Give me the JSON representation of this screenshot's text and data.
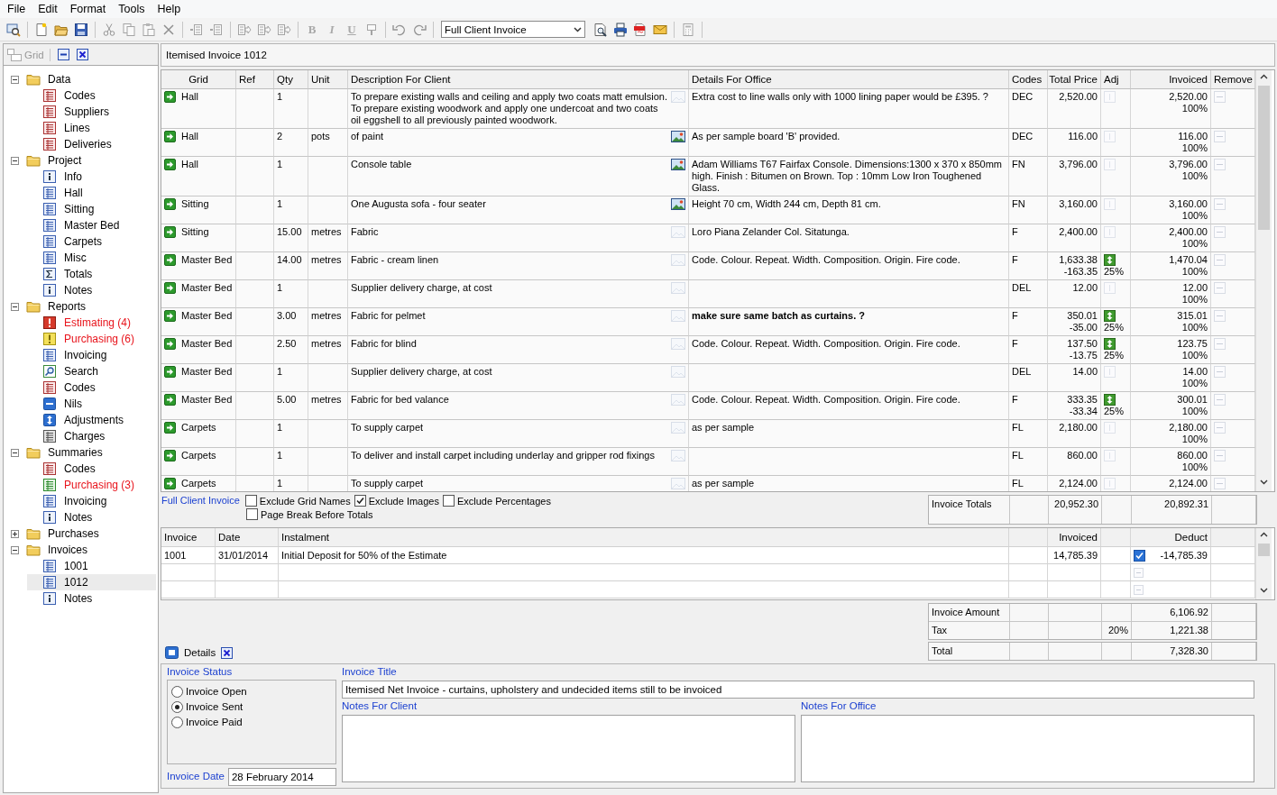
{
  "menu": [
    "File",
    "Edit",
    "Format",
    "Tools",
    "Help"
  ],
  "toolbar": {
    "groups": [
      [
        {
          "kind": "find-window",
          "disabled": false
        }
      ],
      [
        {
          "kind": "new",
          "disabled": false
        },
        {
          "kind": "open",
          "disabled": false
        },
        {
          "kind": "save",
          "disabled": false
        }
      ],
      [
        {
          "kind": "cut",
          "disabled": true
        },
        {
          "kind": "copy",
          "disabled": true
        },
        {
          "kind": "paste",
          "disabled": true
        },
        {
          "kind": "delete",
          "disabled": true
        }
      ],
      [
        {
          "kind": "outdent",
          "disabled": true
        },
        {
          "kind": "indent",
          "disabled": true
        }
      ],
      [
        {
          "kind": "column-in",
          "disabled": true
        },
        {
          "kind": "column-out",
          "disabled": true
        },
        {
          "kind": "column-right",
          "disabled": true
        }
      ],
      [
        {
          "kind": "bold",
          "glyph": "B",
          "disabled": true
        },
        {
          "kind": "italic",
          "glyph": "I",
          "disabled": true
        },
        {
          "kind": "underline",
          "glyph": "U",
          "disabled": true
        },
        {
          "kind": "highlight",
          "disabled": true
        }
      ],
      [
        {
          "kind": "undo",
          "disabled": true
        },
        {
          "kind": "redo",
          "disabled": true
        }
      ]
    ],
    "report": "Full Client Invoice",
    "actions": [
      [
        {
          "kind": "preview",
          "disabled": false
        },
        {
          "kind": "print",
          "disabled": false
        },
        {
          "kind": "pdf",
          "disabled": false
        },
        {
          "kind": "email",
          "disabled": false
        }
      ],
      [
        {
          "kind": "calculator",
          "disabled": true
        }
      ]
    ]
  },
  "sidebar": {
    "grid_button": {
      "label": "Grid",
      "disabled": true
    },
    "tree": [
      {
        "label": "Data",
        "kind": "folder",
        "expanded": true,
        "selected": false,
        "children": [
          {
            "label": "Codes",
            "kind": "table-red",
            "selected": false,
            "alert": false
          },
          {
            "label": "Suppliers",
            "kind": "table-red",
            "selected": false,
            "alert": false
          },
          {
            "label": "Lines",
            "kind": "table-red",
            "selected": false,
            "alert": false
          },
          {
            "label": "Deliveries",
            "kind": "table-red",
            "selected": false,
            "alert": false
          }
        ]
      },
      {
        "label": "Project",
        "kind": "folder",
        "expanded": true,
        "selected": false,
        "children": [
          {
            "label": "Info",
            "kind": "info",
            "selected": false,
            "alert": false
          },
          {
            "label": "Hall",
            "kind": "table-blue",
            "selected": false,
            "alert": false
          },
          {
            "label": "Sitting",
            "kind": "table-blue",
            "selected": false,
            "alert": false
          },
          {
            "label": "Master Bed",
            "kind": "table-blue",
            "selected": false,
            "alert": false
          },
          {
            "label": "Carpets",
            "kind": "table-blue",
            "selected": false,
            "alert": false
          },
          {
            "label": "Misc",
            "kind": "table-blue",
            "selected": false,
            "alert": false
          },
          {
            "label": "Totals",
            "kind": "totals",
            "selected": false,
            "alert": false
          },
          {
            "label": "Notes",
            "kind": "info",
            "selected": false,
            "alert": false
          }
        ]
      },
      {
        "label": "Reports",
        "kind": "folder",
        "expanded": true,
        "selected": false,
        "children": [
          {
            "label": "Estimating (4)",
            "kind": "alert-red",
            "selected": false,
            "alert": true
          },
          {
            "label": "Purchasing (6)",
            "kind": "alert-yellow",
            "selected": false,
            "alert": true
          },
          {
            "label": "Invoicing",
            "kind": "list-blue",
            "selected": false,
            "alert": false
          },
          {
            "label": "Search",
            "kind": "search",
            "selected": false,
            "alert": false
          },
          {
            "label": "Codes",
            "kind": "table-red",
            "selected": false,
            "alert": false
          },
          {
            "label": "Nils",
            "kind": "nil",
            "selected": false,
            "alert": false
          },
          {
            "label": "Adjustments",
            "kind": "adjust",
            "selected": false,
            "alert": false
          },
          {
            "label": "Charges",
            "kind": "table-grey",
            "selected": false,
            "alert": false
          }
        ]
      },
      {
        "label": "Summaries",
        "kind": "folder",
        "expanded": true,
        "selected": false,
        "children": [
          {
            "label": "Codes",
            "kind": "table-red",
            "selected": false,
            "alert": false
          },
          {
            "label": "Purchasing (3)",
            "kind": "list-green",
            "selected": false,
            "alert": true
          },
          {
            "label": "Invoicing",
            "kind": "list-blue",
            "selected": false,
            "alert": false
          },
          {
            "label": "Notes",
            "kind": "info",
            "selected": false,
            "alert": false
          }
        ]
      },
      {
        "label": "Purchases",
        "kind": "folder",
        "expanded": false,
        "selected": false
      },
      {
        "label": "Invoices",
        "kind": "folder",
        "expanded": true,
        "selected": false,
        "children": [
          {
            "label": "1001",
            "kind": "list-blue",
            "selected": false,
            "alert": false
          },
          {
            "label": "1012",
            "kind": "list-blue",
            "selected": true,
            "alert": false
          },
          {
            "label": "Notes",
            "kind": "info",
            "selected": false,
            "alert": false
          }
        ]
      }
    ]
  },
  "title": "Itemised Invoice 1012",
  "grid": {
    "columns": [
      "Grid",
      "Ref",
      "Qty",
      "Unit",
      "Description For Client",
      "Details For Office",
      "Codes",
      "Total Price",
      "Adj",
      "Invoiced",
      "Remove"
    ],
    "rows": [
      {
        "grid": "Hall",
        "qty": "1",
        "description": "To prepare existing walls and ceiling and apply two coats matt emulsion. To prepare existing woodwork and apply one undercoat and two coats oil eggshell to all previously painted woodwork.",
        "has_image": false,
        "details": "Extra cost to line walls only with 1000 lining paper would be £395. ?",
        "details_bold": false,
        "code": "DEC",
        "total": "2,520.00",
        "adjusted": false,
        "invoiced": "2,520.00",
        "invoiced_pct": "100%"
      },
      {
        "grid": "Hall",
        "qty": "2",
        "unit": "pots",
        "description": "of paint",
        "has_image": true,
        "details": "As per sample board 'B' provided.",
        "details_bold": false,
        "code": "DEC",
        "total": "116.00",
        "adjusted": false,
        "invoiced": "116.00",
        "invoiced_pct": "100%"
      },
      {
        "grid": "Hall",
        "qty": "1",
        "description": "Console table",
        "has_image": true,
        "details": "Adam Williams T67 Fairfax Console. Dimensions:1300 x 370 x 850mm high. Finish : Bitumen on Brown. Top : 10mm Low Iron Toughened Glass.",
        "details_bold": false,
        "code": "FN",
        "total": "3,796.00",
        "adjusted": false,
        "invoiced": "3,796.00",
        "invoiced_pct": "100%"
      },
      {
        "grid": "Sitting",
        "qty": "1",
        "description": "One Augusta  sofa - four seater",
        "has_image": true,
        "details": "Height 70 cm, Width 244 cm, Depth 81 cm.",
        "details_bold": false,
        "code": "FN",
        "total": "3,160.00",
        "adjusted": false,
        "invoiced": "3,160.00",
        "invoiced_pct": "100%"
      },
      {
        "grid": "Sitting",
        "qty": "15.00",
        "unit": "metres",
        "description": "Fabric",
        "has_image": false,
        "details": "Loro Piana Zelander Col. Sitatunga.",
        "details_bold": false,
        "code": "F",
        "total": "2,400.00",
        "adjusted": false,
        "invoiced": "2,400.00",
        "invoiced_pct": "100%"
      },
      {
        "grid": "Master Bed",
        "qty": "14.00",
        "unit": "metres",
        "description": "Fabric - cream linen",
        "has_image": false,
        "details": "Code. Colour. Repeat. Width. Composition. Origin. Fire code.",
        "details_bold": false,
        "code": "F",
        "total": "1,633.38",
        "adjustment": "-163.35",
        "adjusted": true,
        "adj_pct": "25%",
        "invoiced": "1,470.04",
        "invoiced_pct": "100%"
      },
      {
        "grid": "Master Bed",
        "qty": "1",
        "description": "Supplier delivery charge, at cost",
        "has_image": false,
        "code": "DEL",
        "total": "12.00",
        "adjusted": false,
        "invoiced": "12.00",
        "invoiced_pct": "100%"
      },
      {
        "grid": "Master Bed",
        "qty": "3.00",
        "unit": "metres",
        "description": "Fabric for pelmet",
        "has_image": false,
        "details": "make sure same batch as curtains. ?",
        "details_bold": true,
        "code": "F",
        "total": "350.01",
        "adjustment": "-35.00",
        "adjusted": true,
        "adj_pct": "25%",
        "invoiced": "315.01",
        "invoiced_pct": "100%"
      },
      {
        "grid": "Master Bed",
        "qty": "2.50",
        "unit": "metres",
        "description": "Fabric for blind",
        "has_image": false,
        "details": "Code. Colour. Repeat. Width. Composition. Origin. Fire code.",
        "details_bold": false,
        "code": "F",
        "total": "137.50",
        "adjustment": "-13.75",
        "adjusted": true,
        "adj_pct": "25%",
        "invoiced": "123.75",
        "invoiced_pct": "100%"
      },
      {
        "grid": "Master Bed",
        "qty": "1",
        "description": "Supplier delivery charge, at cost",
        "has_image": false,
        "code": "DEL",
        "total": "14.00",
        "adjusted": false,
        "invoiced": "14.00",
        "invoiced_pct": "100%"
      },
      {
        "grid": "Master Bed",
        "qty": "5.00",
        "unit": "metres",
        "description": "Fabric for bed valance",
        "has_image": false,
        "details": "Code. Colour. Repeat. Width. Composition. Origin. Fire code.",
        "details_bold": false,
        "code": "F",
        "total": "333.35",
        "adjustment": "-33.34",
        "adjusted": true,
        "adj_pct": "25%",
        "invoiced": "300.01",
        "invoiced_pct": "100%"
      },
      {
        "grid": "Carpets",
        "qty": "1",
        "description": "To supply carpet",
        "has_image": false,
        "details": "as per sample",
        "details_bold": false,
        "code": "FL",
        "total": "2,180.00",
        "adjusted": false,
        "invoiced": "2,180.00",
        "invoiced_pct": "100%"
      },
      {
        "grid": "Carpets",
        "qty": "1",
        "description": "To deliver and install carpet including underlay and gripper rod fixings",
        "has_image": false,
        "code": "FL",
        "total": "860.00",
        "adjusted": false,
        "invoiced": "860.00",
        "invoiced_pct": "100%"
      },
      {
        "grid": "Carpets",
        "qty": "1",
        "description": "To supply carpet",
        "has_image": false,
        "details": "as per sample",
        "details_bold": false,
        "code": "FL",
        "total": "2,124.00",
        "adjusted": false,
        "invoiced": "2,124.00"
      }
    ]
  },
  "options": {
    "link": "Full Client Invoice",
    "checkboxes": [
      {
        "label": "Exclude Grid Names",
        "checked": false
      },
      {
        "label": "Exclude Images",
        "checked": true
      },
      {
        "label": "Exclude Percentages",
        "checked": false
      },
      {
        "label": "Page Break Before Totals",
        "checked": false
      }
    ]
  },
  "invoice_totals": {
    "label": "Invoice Totals",
    "total": "20,952.30",
    "invoiced": "20,892.31"
  },
  "instalments": {
    "columns": [
      "Invoice",
      "Date",
      "Instalment",
      "Invoiced",
      "Deduct"
    ],
    "rows": [
      {
        "kind": "entry",
        "invoice": "1001",
        "date": "31/01/2014",
        "instalment": "Initial Deposit for 50% of the Estimate",
        "invoiced": "14,785.39",
        "checked": true,
        "deduct": "-14,785.39"
      },
      {
        "kind": "blank"
      },
      {
        "kind": "blank"
      }
    ]
  },
  "summary": {
    "rows": [
      {
        "label": "Invoice Amount",
        "value": "6,106.92"
      },
      {
        "label": "Tax",
        "rate": "20%",
        "value": "1,221.38"
      }
    ],
    "total": {
      "label": "Total",
      "value": "7,328.30"
    }
  },
  "details": {
    "title": "Details",
    "status_label": "Invoice Status",
    "statuses": [
      {
        "label": "Invoice Open",
        "selected": false
      },
      {
        "label": "Invoice Sent",
        "selected": true
      },
      {
        "label": "Invoice Paid",
        "selected": false
      }
    ],
    "date_label": "Invoice Date",
    "date": "28 February 2014",
    "title_label": "Invoice Title",
    "invoice_title": "Itemised Net Invoice - curtains, upholstery and undecided items still to be invoiced",
    "client_notes_label": "Notes For Client",
    "office_notes_label": "Notes For Office"
  }
}
